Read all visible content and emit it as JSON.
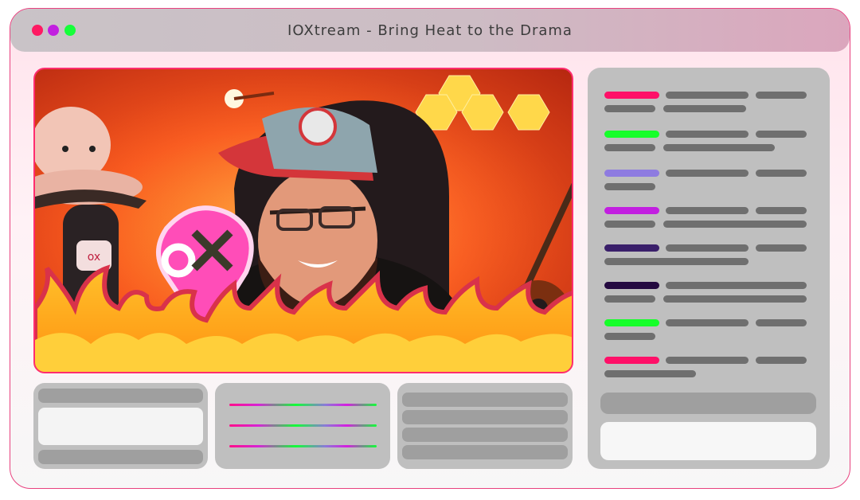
{
  "window": {
    "title": "IOXtream - Bring Heat to the Drama",
    "controls": [
      {
        "name": "close",
        "color": "#ff1a63"
      },
      {
        "name": "minimize",
        "color": "#c21fe0"
      },
      {
        "name": "maximize",
        "color": "#16ff3a"
      }
    ]
  },
  "video": {
    "brand_colors": {
      "fire": "#f8561e",
      "flame_outline": "#d9324a",
      "logo_pink": "#ff4db8"
    }
  },
  "chat": {
    "messages": [
      {
        "name_color": "#ff1068"
      },
      {
        "name_color": "#16ff2a"
      },
      {
        "name_color": "#8e7be0"
      },
      {
        "name_color": "#c21fe0"
      },
      {
        "name_color": "#3a1f6a"
      },
      {
        "name_color": "#240a40"
      },
      {
        "name_color": "#16ff2a"
      },
      {
        "name_color": "#ff1068"
      }
    ]
  }
}
